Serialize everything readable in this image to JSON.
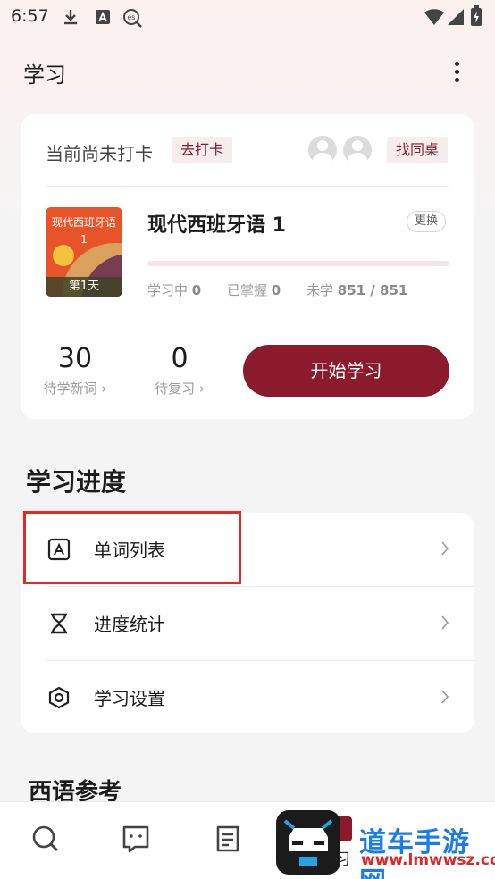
{
  "status_bar": {
    "time": "6:57",
    "left_icons": [
      "download-icon",
      "a-box-icon",
      "es-search-icon"
    ],
    "right_icons": [
      "wifi-icon",
      "signal-icon",
      "battery-charging-icon"
    ]
  },
  "header": {
    "title": "学习",
    "more_icon": "more-vertical-icon"
  },
  "checkin": {
    "status_text": "当前尚未打卡",
    "checkin_label": "去打卡",
    "find_deskmate_label": "找同桌"
  },
  "book": {
    "cover_title": "现代西班牙语 1",
    "cover_day": "第1天",
    "title": "现代西班牙语 1",
    "change_label": "更换",
    "progress_fraction": 0,
    "stats": {
      "learning_label": "学习中",
      "learning_value": "0",
      "mastered_label": "已掌握",
      "mastered_value": "0",
      "unlearned_label": "未学",
      "unlearned_value": "851 / 851"
    }
  },
  "counts": {
    "new_words_num": "30",
    "new_words_label": "待学新词 ›",
    "review_num": "0",
    "review_label": "待复习 ›"
  },
  "start_button_label": "开始学习",
  "progress_section": {
    "title": "学习进度",
    "items": [
      {
        "label": "单词列表",
        "icon": "word-list-icon"
      },
      {
        "label": "进度统计",
        "icon": "hourglass-icon"
      },
      {
        "label": "学习设置",
        "icon": "settings-hex-icon"
      }
    ]
  },
  "reference_section": {
    "title": "西语参考"
  },
  "bottom_nav": {
    "items": [
      {
        "icon": "search-icon"
      },
      {
        "icon": "chat-face-icon"
      },
      {
        "icon": "document-icon"
      },
      {
        "icon": "study-icon",
        "label": "习",
        "active": true
      }
    ]
  },
  "watermark": {
    "line1": "道车手游网",
    "line2": "www.lmwwsz.com"
  },
  "colors": {
    "accent": "#8b1b2c",
    "highlight": "#e32a22"
  }
}
